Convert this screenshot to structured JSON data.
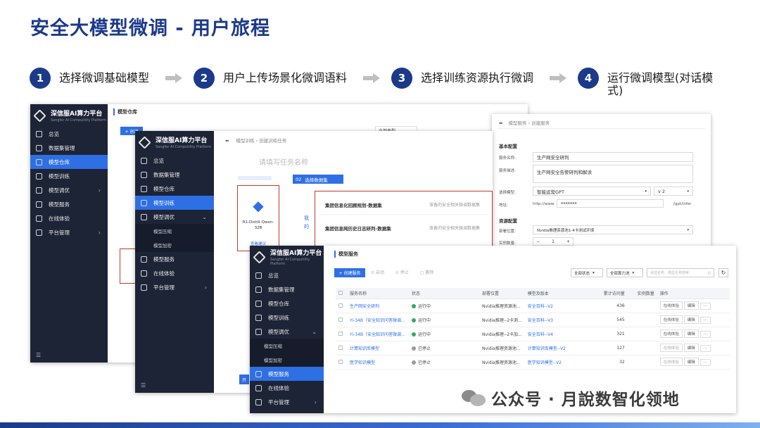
{
  "title": "安全大模型微调 - 用户旅程",
  "steps": [
    {
      "num": "1",
      "label": "选择微调基础模型"
    },
    {
      "num": "2",
      "label": "用户上传场景化微调语料"
    },
    {
      "num": "3",
      "label": "选择训练资源执行微调"
    },
    {
      "num": "4",
      "label": "运行微调模型(对话模式)"
    }
  ],
  "platform": {
    "name": "深信服AI算力平台",
    "subtitle": "Sangfor AI Computility Platform"
  },
  "nav": {
    "overview": "总览",
    "dataset": "数据集管理",
    "repo": "模型仓库",
    "train": "模型训练",
    "tune": "模型调优",
    "compress": "模型压缩",
    "encrypt": "模型加密",
    "service": "模型服务",
    "online": "在线体验",
    "platform_admin": "平台管理"
  },
  "win1": {
    "section": "模型仓库",
    "create": "+ 创建",
    "filter": "全部类型"
  },
  "win2": {
    "crumb1": "模型训练",
    "crumb2": "创建训练任务",
    "name_placeholder": "请填写任务名称",
    "step_num": "02",
    "step_label": "选择数据集",
    "model_name": "R1-Distill-Qwen-32B",
    "model_link": "查看建议",
    "side_chars": "我的",
    "datasets": [
      {
        "name": "集团信息化回顾规划-数据集",
        "desc": "准备的安全相关微调数据集"
      },
      {
        "name": "集团信息网历史日志研判-数据集",
        "desc": "准备的安全相关微调数据集"
      }
    ],
    "next_btn": "开"
  },
  "win3": {
    "crumb1": "模型服务",
    "crumb2": "创建服务",
    "basic": "基本配置",
    "name_label": "服务名称:",
    "name_value": "生产网安全研判",
    "desc_label": "服务描述:",
    "desc_value": "生产网安全告警研判和解读",
    "model_label": "选择模型:",
    "model_value": "智能运营GPT",
    "version_value": "v 2",
    "url_label": "地址:",
    "url_prefix": "http://www.",
    "url_mask": "xxxxxxx",
    "url_suffix": "/gpt/infer",
    "resource": "资源配置",
    "deploy_label": "部署位置:",
    "deploy_value": "Nvidia推理资源池1-4卡测试环境",
    "inst_label": "实例数量:",
    "inst_value": "1"
  },
  "win4": {
    "section": "模型服务",
    "create": "+ 创建服务",
    "start": "启动",
    "stop": "停止",
    "delete": "删除",
    "filter_status": "全部状态",
    "filter_deploy": "全部算力池",
    "search_placeholder": "请选名称、模型名称搜索",
    "columns": [
      "服务名称",
      "状态",
      "部署位置",
      "模型及版本",
      "累计访问量",
      "实例数量",
      "操作"
    ],
    "rows": [
      {
        "name": "生产网安全研判",
        "status": "运行中",
        "deploy": "Nvidia推理资源池...",
        "model": "安全百科--V2",
        "visits": "436"
      },
      {
        "name": "Yi-34B（安全知识问答微调...",
        "status": "运行中",
        "deploy": "Nvidia推理--2卡测...",
        "model": "安全百科--V3",
        "visits": "545"
      },
      {
        "name": "Yi-34B（安全知识问答微调...",
        "status": "运行中",
        "deploy": "Nvidia推理--2卡加...",
        "model": "安全百科--V4",
        "visits": "321"
      },
      {
        "name": "计算知识库模型",
        "status": "已停止",
        "deploy": "Nvidia推理资源池...",
        "model": "计算知识库模型--V2",
        "visits": "127"
      },
      {
        "name": "医学知识模型",
        "status": "已停止",
        "deploy": "Nvidia推理资源池...",
        "model": "医学知识模型--V2",
        "visits": "32"
      }
    ],
    "op_chat": "在线体验",
    "op_edit": "编辑",
    "op_more": "···"
  },
  "watermark": "公众号 · 月說数智化领地",
  "colors": {
    "title": "#1c3a8a",
    "accent": "#2f6fe4",
    "sidebar": "#1d2436",
    "running": "#2eab5e",
    "stopped": "#9a9a9a",
    "highlight": "#c0392b"
  }
}
